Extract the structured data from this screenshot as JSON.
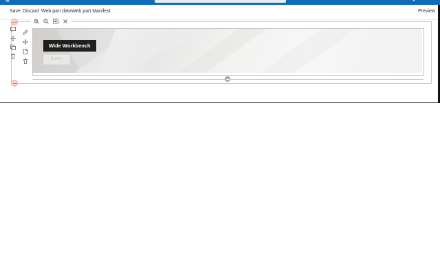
{
  "suite_bar": {
    "site_name": "",
    "search_placeholder": "",
    "accent_color": "#0f6cbd"
  },
  "command_bar": {
    "save_label": "Save",
    "discard_label": "Discard",
    "webpart_data_label": "Web part data",
    "webpart_manifest_label": "Web part Manifest",
    "preview_label": "Preview"
  },
  "section_toolbar": {
    "icons": [
      "edit-section-icon",
      "move-section-icon",
      "duplicate-section-icon",
      "delete-section-icon"
    ]
  },
  "zoom_toolbar": {
    "icons": [
      "zoom-in-icon",
      "zoom-out-icon",
      "fit-screen-icon",
      "close-icon"
    ]
  },
  "webpart_toolbar": {
    "icons": [
      "edit-icon",
      "move-icon",
      "duplicate-icon",
      "delete-icon"
    ]
  },
  "hero": {
    "title": "Wide Workbench",
    "button_label": "Button"
  },
  "colors": {
    "section_outline": "#f1b9b0",
    "badge_background": "#201f1e"
  }
}
